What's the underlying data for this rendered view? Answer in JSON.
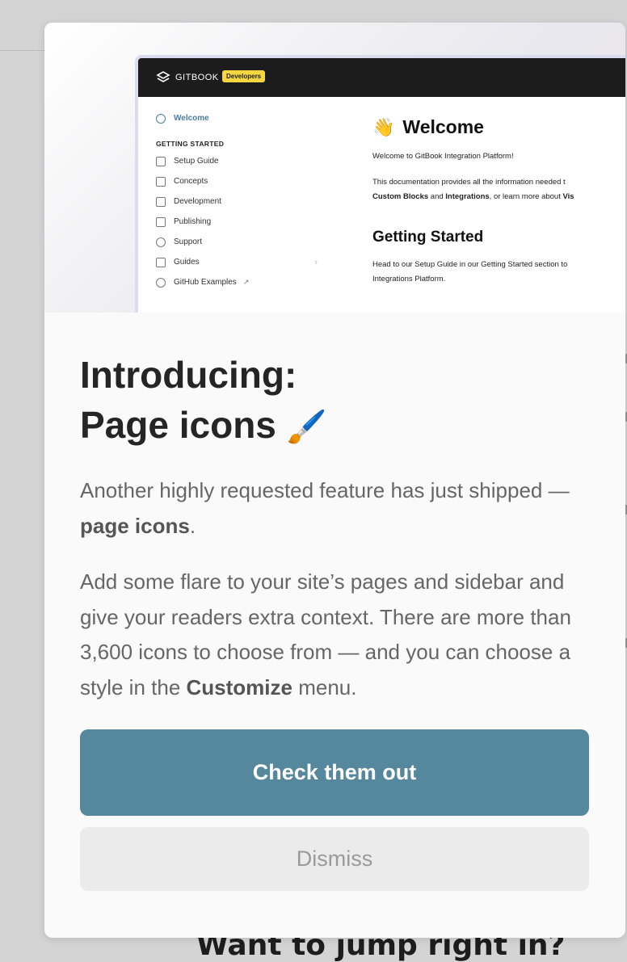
{
  "background": {
    "partial_heading": "Want to jump right in?"
  },
  "modal": {
    "preview": {
      "logo_text": "GITBOOK",
      "badge": "Developers",
      "sidebar": {
        "welcome": "Welcome",
        "section": "GETTING STARTED",
        "items": [
          "Setup Guide",
          "Concepts",
          "Development",
          "Publishing",
          "Support",
          "Guides",
          "GitHub Examples"
        ]
      },
      "doc": {
        "title": "Welcome",
        "intro": "Welcome to GitBook Integration Platform!",
        "line1": "This documentation provides all the information needed t",
        "line2_pre": "Custom Blocks",
        "line2_mid": " and ",
        "line2_bold": "Integrations",
        "line2_post": ", or learn more about ",
        "line2_end": "Vis",
        "heading": "Getting Started",
        "para_line1": "Head to our Setup Guide in our Getting Started section to",
        "para_line2": "Integrations Platform."
      }
    },
    "headline_line1": "Introducing:",
    "headline_line2": "Page icons",
    "headline_emoji": "🖌️",
    "para1_text": "Another highly requested feature has just shipped — ",
    "para1_bold": "page icons",
    "para1_end": ".",
    "para2_text": "Add some flare to your site’s pages and sidebar and give your readers extra context. There are more than 3,600 icons to choose from — and you can choose a style in the ",
    "para2_bold": "Customize",
    "para2_end": " menu.",
    "cta_label": "Check them out",
    "dismiss_label": "Dismiss"
  },
  "colors": {
    "cta": "#55879d",
    "dismiss_bg": "#ebebeb",
    "badge": "#f5d640"
  }
}
